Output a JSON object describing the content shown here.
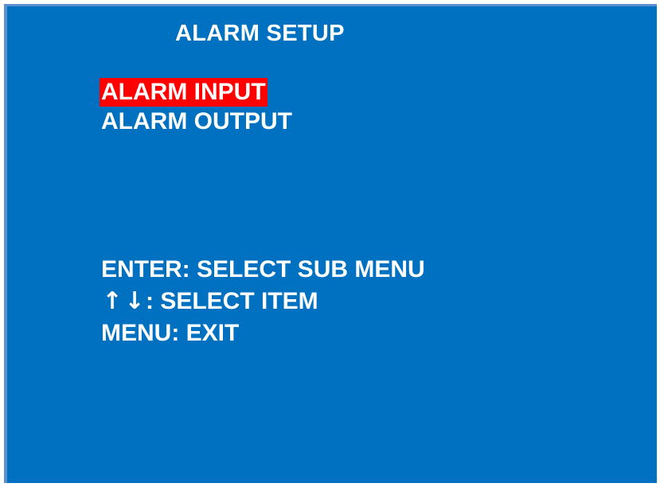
{
  "screen": {
    "title": "ALARM SETUP",
    "background_color": "#0070c0",
    "highlight_color": "#ff0000"
  },
  "menu": {
    "items": [
      {
        "label": "ALARM INPUT",
        "selected": true
      },
      {
        "label": "ALARM OUTPUT",
        "selected": false
      }
    ]
  },
  "help": {
    "enter_line": "ENTER: SELECT SUB MENU",
    "up_arrow": "↑",
    "down_arrow": "↓",
    "arrows_line": ": SELECT ITEM",
    "menu_line": "MENU: EXIT"
  }
}
